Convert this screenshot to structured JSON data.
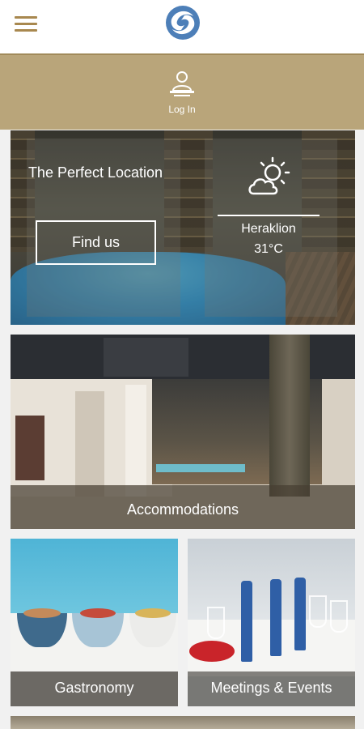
{
  "header": {
    "menu_icon": "hamburger-menu-icon",
    "logo_icon": "hotel-logo-icon",
    "brand_color": "#a8884f"
  },
  "login": {
    "icon": "user-login-icon",
    "label": "Log In",
    "background": "#b9a57a"
  },
  "hero": {
    "title": "The Perfect Location",
    "find_button": "Find us",
    "weather": {
      "icon": "partly-cloudy-icon",
      "city": "Heraklion",
      "temperature": "31°C"
    }
  },
  "sections": [
    {
      "label": "Accommodations"
    },
    {
      "label": "Gastronomy"
    },
    {
      "label": "Meetings & Events"
    }
  ]
}
